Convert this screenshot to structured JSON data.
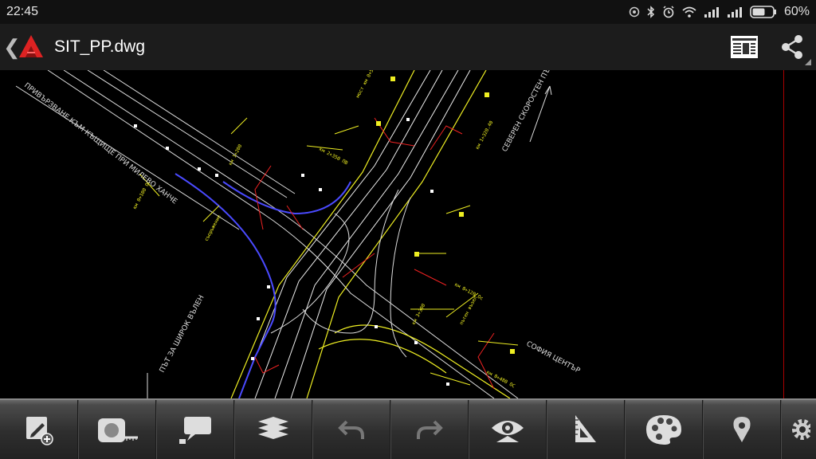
{
  "status_bar": {
    "time": "22:45",
    "battery_percent": "60%",
    "icons": [
      "sync-icon",
      "bluetooth-icon",
      "alarm-icon",
      "wifi-icon",
      "signal-1-icon",
      "signal-2-icon",
      "battery-icon"
    ]
  },
  "app_bar": {
    "title": "SIT_PP.dwg",
    "actions": [
      "sheet-layout-icon",
      "share-icon"
    ]
  },
  "drawing": {
    "labels": {
      "road_top_left": "ПРИВЪРЗВАНЕ КЪМ КЪЩИЩЕ ПРИ МИЛЕВО ХАНЧЕ",
      "road_right": "СЕВЕРЕН СКОРОСТЕН ПЪТ",
      "road_bottom_left": "ПЪТ ЗА ШИРОК ВЪЛЕН",
      "road_bottom_right": "СОФИЯ ЦЕНТЪР"
    },
    "colors": {
      "road": "#ffffff",
      "ramp": "#4a4aff",
      "annotation": "#ffff00",
      "leader": "#ff2020",
      "border": "#aa0000"
    }
  },
  "toolbar": {
    "tools": [
      {
        "name": "edit-add-tool",
        "icon": "pencil-plus-icon"
      },
      {
        "name": "measure-tool",
        "icon": "tape-measure-icon"
      },
      {
        "name": "annotate-tool",
        "icon": "speech-bubble-icon"
      },
      {
        "name": "layers-tool",
        "icon": "layers-icon"
      },
      {
        "name": "undo-tool",
        "icon": "undo-icon"
      },
      {
        "name": "redo-tool",
        "icon": "redo-icon"
      },
      {
        "name": "view-tool",
        "icon": "eye-icon"
      },
      {
        "name": "draft-tool",
        "icon": "triangle-ruler-icon"
      },
      {
        "name": "color-tool",
        "icon": "palette-icon"
      },
      {
        "name": "location-tool",
        "icon": "map-pin-icon"
      },
      {
        "name": "settings-tool",
        "icon": "gear-icon"
      }
    ]
  }
}
